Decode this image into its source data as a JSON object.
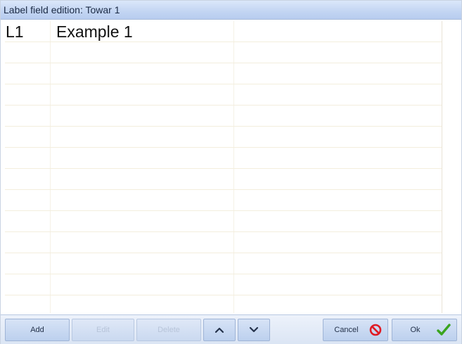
{
  "window": {
    "title": "Label field edition: Towar 1"
  },
  "rows": [
    {
      "id": "L1",
      "value": "Example 1"
    }
  ],
  "toolbar": {
    "add_label": "Add",
    "edit_label": "Edit",
    "delete_label": "Delete",
    "cancel_label": "Cancel",
    "ok_label": "Ok"
  },
  "icons": {
    "up": "chevron-up-icon",
    "down": "chevron-down-icon",
    "cancel": "no-entry-icon",
    "ok": "checkmark-icon"
  },
  "colors": {
    "title_bar": "#c4d6f3",
    "button": "#c9daf2",
    "cancel_icon": "#e01b24",
    "ok_icon": "#3aa41e"
  }
}
